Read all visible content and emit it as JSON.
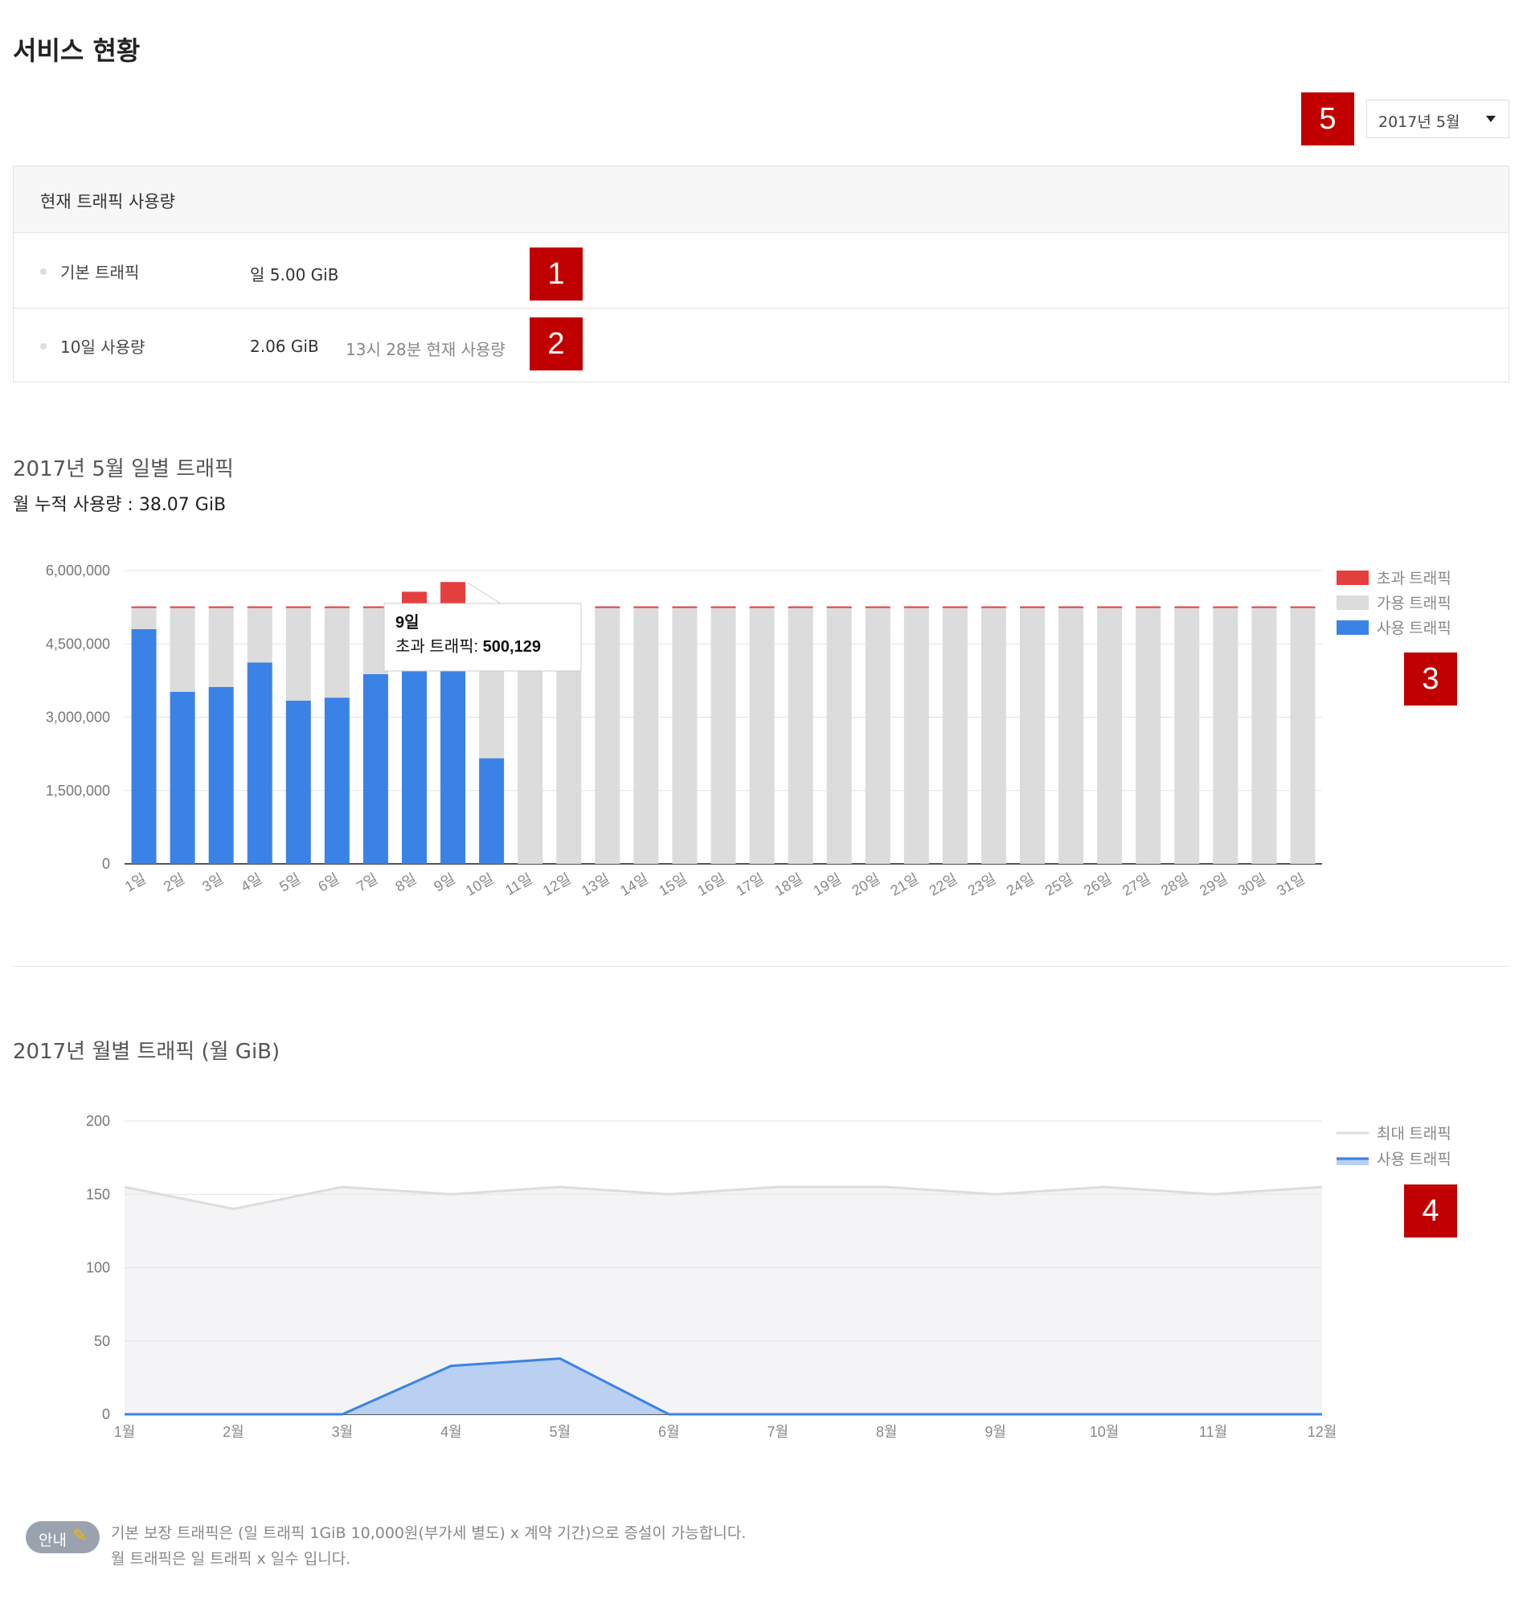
{
  "page_title": "서비스 현황",
  "month_select": {
    "selected": "2017년 5월"
  },
  "markers": [
    "1",
    "2",
    "3",
    "4",
    "5"
  ],
  "traffic_card": {
    "title": "현재 트래픽 사용량",
    "rows": [
      {
        "label": "기본 트래픽",
        "value": "일 5.00 GiB",
        "note": ""
      },
      {
        "label": "10일 사용량",
        "value": "2.06 GiB",
        "note": "13시 28분 현재 사용량"
      }
    ]
  },
  "daily_section": {
    "title": "2017년 5월 일별 트래픽",
    "subtitle": "월 누적 사용량 : 38.07 GiB"
  },
  "monthly_section": {
    "title": "2017년 월별 트래픽 (월 GiB)"
  },
  "colors": {
    "used": "#3b82e6",
    "available": "#dcdcdc",
    "excess": "#e53e3e",
    "marker": "#c00000"
  },
  "chart_data": [
    {
      "type": "bar",
      "stacked": true,
      "categories": [
        "1일",
        "2일",
        "3일",
        "4일",
        "5일",
        "6일",
        "7일",
        "8일",
        "9일",
        "10일",
        "11일",
        "12일",
        "13일",
        "14일",
        "15일",
        "16일",
        "17일",
        "18일",
        "19일",
        "20일",
        "21일",
        "22일",
        "23일",
        "24일",
        "25일",
        "26일",
        "27일",
        "28일",
        "29일",
        "30일",
        "31일"
      ],
      "series": [
        {
          "name": "사용 트래픽",
          "color": "#3b82e6",
          "values": [
            4800000,
            3520000,
            3620000,
            4120000,
            3340000,
            3400000,
            3880000,
            4020000,
            4020000,
            2160000,
            0,
            0,
            0,
            0,
            0,
            0,
            0,
            0,
            0,
            0,
            0,
            0,
            0,
            0,
            0,
            0,
            0,
            0,
            0,
            0,
            0
          ]
        },
        {
          "name": "가용 트래픽",
          "color": "#dcdcdc",
          "values": [
            450000,
            1730000,
            1630000,
            1130000,
            1910000,
            1850000,
            1370000,
            1230000,
            1230000,
            3090000,
            5250000,
            5250000,
            5250000,
            5250000,
            5250000,
            5250000,
            5250000,
            5250000,
            5250000,
            5250000,
            5250000,
            5250000,
            5250000,
            5250000,
            5250000,
            5250000,
            5250000,
            5250000,
            5250000,
            5250000,
            5250000
          ]
        },
        {
          "name": "초과 트래픽",
          "color": "#e53e3e",
          "values": [
            0,
            0,
            0,
            0,
            0,
            0,
            0,
            300000,
            500129,
            0,
            0,
            0,
            0,
            0,
            0,
            0,
            0,
            0,
            0,
            0,
            0,
            0,
            0,
            0,
            0,
            0,
            0,
            0,
            0,
            0,
            0
          ]
        }
      ],
      "y_ticks": [
        "6,000,000",
        "4,500,000",
        "3,000,000",
        "1,500,000",
        "0"
      ],
      "y_tick_values": [
        6000000,
        4500000,
        3000000,
        1500000,
        0
      ],
      "ylim": [
        0,
        6000000
      ],
      "legend": "right",
      "grid": true,
      "tooltip": {
        "title": "9일",
        "label": "초과 트래픽: ",
        "value": "500,129"
      }
    },
    {
      "type": "area",
      "categories": [
        "1월",
        "2월",
        "3월",
        "4월",
        "5월",
        "6월",
        "7월",
        "8월",
        "9월",
        "10월",
        "11월",
        "12월"
      ],
      "series": [
        {
          "name": "최대 트래픽",
          "color": "#dddddd",
          "values": [
            155,
            140,
            155,
            150,
            155,
            150,
            155,
            155,
            150,
            155,
            150,
            155
          ]
        },
        {
          "name": "사용 트래픽",
          "color": "#3b82e6",
          "values": [
            0,
            0,
            0,
            33,
            38,
            0,
            0,
            0,
            0,
            0,
            0,
            0
          ]
        }
      ],
      "y_ticks": [
        "200",
        "150",
        "100",
        "50",
        "0"
      ],
      "y_tick_values": [
        200,
        150,
        100,
        50,
        0
      ],
      "ylim": [
        0,
        200
      ],
      "legend": "right",
      "grid": true
    }
  ],
  "notice": {
    "badge": "안내",
    "lines": [
      "기본 보장 트래픽은 (일 트래픽 1GiB 10,000원(부가세 별도) x 계약 기간)으로 증설이 가능합니다.",
      "월 트래픽은 일 트래픽 x 일수 입니다."
    ]
  }
}
